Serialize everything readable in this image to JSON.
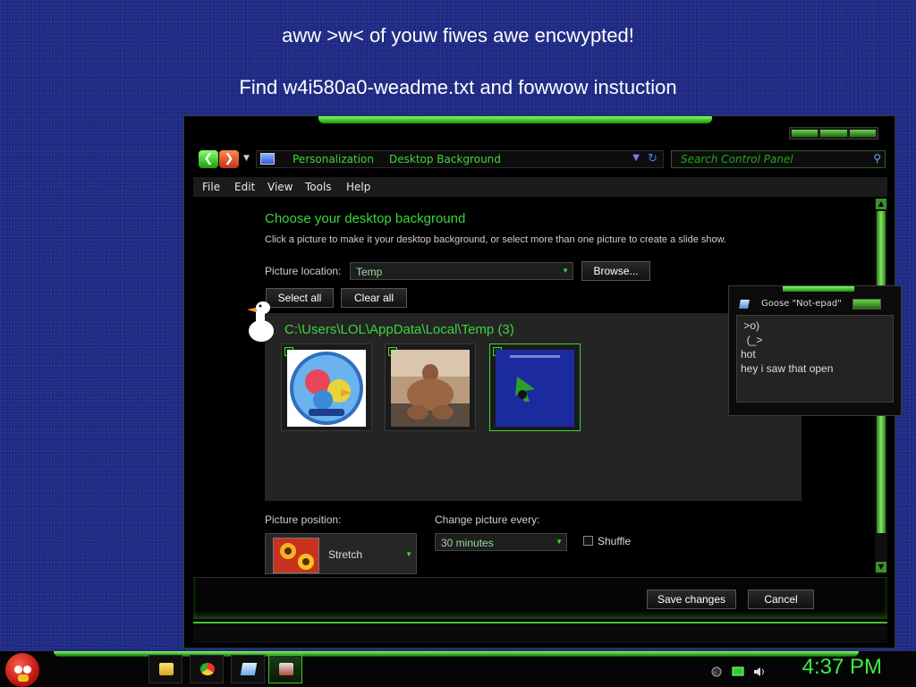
{
  "ransom": {
    "line1": "aww >w< of youw fiwes awe encwypted!",
    "line2": "Find w4i580a0-weadme.txt and fowwow instuction"
  },
  "window": {
    "address": {
      "crumb1": "Personalization",
      "crumb2": "Desktop Background",
      "search_placeholder": "Search Control Panel"
    },
    "menu": [
      "File",
      "Edit",
      "View",
      "Tools",
      "Help"
    ],
    "heading": "Choose your desktop background",
    "subtext": "Click a picture to make it your desktop background, or select more than one picture to create a slide show.",
    "picture_location_label": "Picture location:",
    "picture_location_value": "Temp",
    "browse_label": "Browse...",
    "select_all_label": "Select all",
    "clear_all_label": "Clear all",
    "folder_path": "C:\\Users\\LOL\\AppData\\Local\\Temp (3)",
    "picture_position_label": "Picture position:",
    "picture_position_value": "Stretch",
    "change_every_label": "Change picture every:",
    "change_every_value": "30 minutes",
    "shuffle_label": "Shuffle",
    "save_label": "Save changes",
    "cancel_label": "Cancel"
  },
  "goose_notepad": {
    "title": "Goose \"Not-epad\"",
    "lines": [
      " >o)",
      "  (_>",
      "hot",
      "hey i saw that open"
    ]
  },
  "taskbar": {
    "clock": "4:37 PM"
  },
  "colors": {
    "accent": "#3bd43b",
    "desktop": "#1f2a86"
  }
}
